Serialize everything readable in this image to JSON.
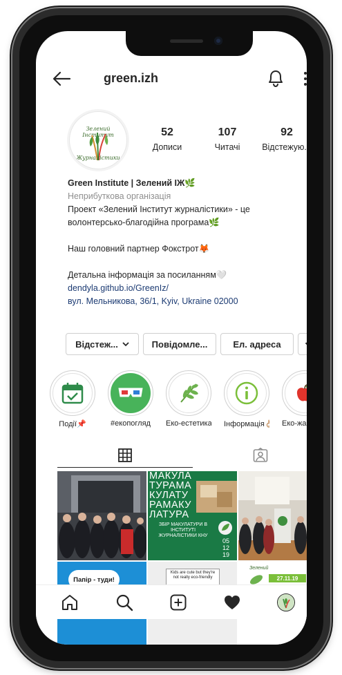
{
  "header": {
    "username": "green.izh",
    "back_icon": "arrow-left-icon",
    "bell_icon": "bell-icon",
    "more_icon": "more-vertical-icon"
  },
  "profile": {
    "avatar_text_top": "Зелений Інститут",
    "avatar_text_bottom": "Журналістики",
    "stats": [
      {
        "value": "52",
        "label": "Дописи"
      },
      {
        "value": "107",
        "label": "Читачі"
      },
      {
        "value": "92",
        "label": "Відстежую..."
      }
    ],
    "name": "Green Institute | Зелений ІЖ🌿",
    "category": "Неприбуткова організація",
    "bio_lines": [
      "Проект «Зелений Інститут журналістики» - це",
      "волонтерсько-благодійна програма🌿",
      "",
      "Наш головний партнер Фокстрот🦊",
      "",
      "Детальна інформація за посиланням🤍"
    ],
    "link": "dendyla.github.io/GreenIz/",
    "address": "вул. Мельникова, 36/1, Kyiv, Ukraine 02000"
  },
  "buttons": {
    "follow": "Відстеж...",
    "message": "Повідомле...",
    "email": "Ел. адреса",
    "dropdown_icon": "chevron-down-icon"
  },
  "highlights": [
    {
      "label": "Події📌",
      "icon": "calendar-check-icon"
    },
    {
      "label": "#екопогляд",
      "icon": "3d-glasses-icon"
    },
    {
      "label": "Еко-естетика...",
      "icon": "leaf-branch-icon"
    },
    {
      "label": "Інформація👌🏼",
      "icon": "info-icon"
    },
    {
      "label": "Еко-жар",
      "icon": "apple-icon"
    }
  ],
  "tabs": [
    {
      "name": "grid",
      "icon": "grid-icon"
    },
    {
      "name": "tagged",
      "icon": "tagged-person-icon"
    }
  ],
  "posts": {
    "post2_title": "МАКУЛА ТУРАМА КУЛАТУ РАМАКУ ЛАТУРА",
    "post2_subtitle": "ЗБІР МАКУЛАТУРИ В ІНСТИТУТІ ЖУРНАЛІСТИКИ КНУ",
    "post2_date": "05 12 19",
    "post4_text": "Папір - туди!",
    "post5_text": "Kids are cute but they're not really eco-friendly",
    "post6_brand": "Зелений",
    "post6_date": "27.11.19"
  },
  "bottom_nav": [
    {
      "name": "home",
      "icon": "home-icon"
    },
    {
      "name": "search",
      "icon": "search-icon"
    },
    {
      "name": "add",
      "icon": "add-square-icon"
    },
    {
      "name": "activity",
      "icon": "heart-icon"
    },
    {
      "name": "profile",
      "icon": "profile-avatar-icon"
    }
  ],
  "colors": {
    "link": "#1b3a72",
    "muted": "#8e8e8e",
    "text": "#262626",
    "green": "#2e8b4a"
  }
}
